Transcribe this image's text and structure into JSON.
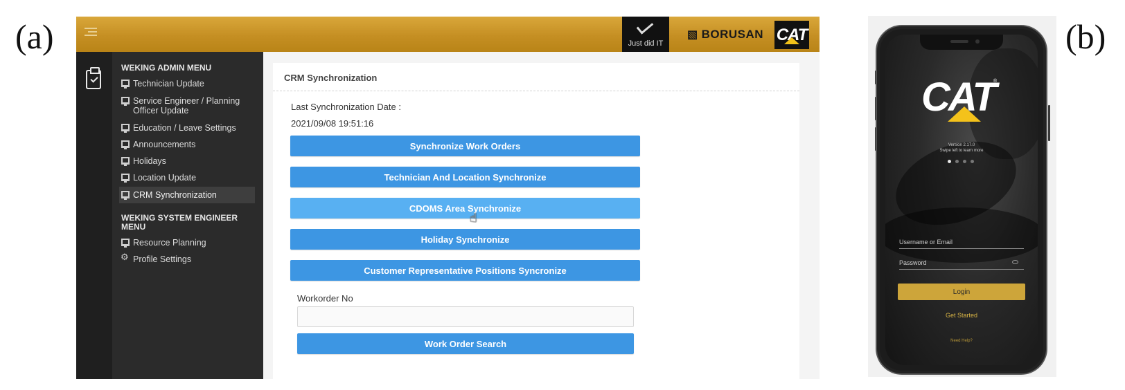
{
  "labels": {
    "panel_a": "(a)",
    "panel_b": "(b)"
  },
  "web": {
    "header": {
      "justdid_text": "Just did IT",
      "borusan_text": "BORUSAN",
      "cat_text": "CAT",
      "brand_color": "#c7912a"
    },
    "sidebar": {
      "admin_heading": "WEKING ADMIN MENU",
      "admin_items": [
        {
          "label": "Technician Update",
          "icon": "monitor-icon"
        },
        {
          "label": "Service Engineer / Planning Officer Update",
          "icon": "monitor-icon"
        },
        {
          "label": "Education / Leave Settings",
          "icon": "monitor-icon"
        },
        {
          "label": "Announcements",
          "icon": "monitor-icon"
        },
        {
          "label": "Holidays",
          "icon": "monitor-icon"
        },
        {
          "label": "Location Update",
          "icon": "monitor-icon"
        },
        {
          "label": "CRM Synchronization",
          "icon": "monitor-icon",
          "active": true
        }
      ],
      "engineer_heading": "WEKING SYSTEM ENGINEER MENU",
      "engineer_items": [
        {
          "label": "Resource Planning",
          "icon": "monitor-icon"
        },
        {
          "label": "Profile Settings",
          "icon": "gears-icon"
        }
      ]
    },
    "main": {
      "title": "CRM Synchronization",
      "last_sync_label": "Last Synchronization Date :",
      "last_sync_value": "2021/09/08 19:51:16",
      "buttons": [
        "Synchronize Work Orders",
        "Technician And Location Synchronize",
        "CDOMS Area Synchronize",
        "Holiday Synchronize",
        "Customer Representative Positions Syncronize"
      ],
      "workorder_label": "Workorder No",
      "workorder_value": "",
      "search_button": "Work Order Search",
      "button_color": "#3d96e3"
    }
  },
  "mobile": {
    "logo_text": "CAT",
    "logo_reg": "®",
    "version_line1": "Version 2.17.0",
    "version_line2": "Swipe left to learn more",
    "username_placeholder": "Username or Email",
    "password_placeholder": "Password",
    "login_button": "Login",
    "get_started": "Get Started",
    "need_help": "Need Help?",
    "accent_color": "#cda53a"
  }
}
